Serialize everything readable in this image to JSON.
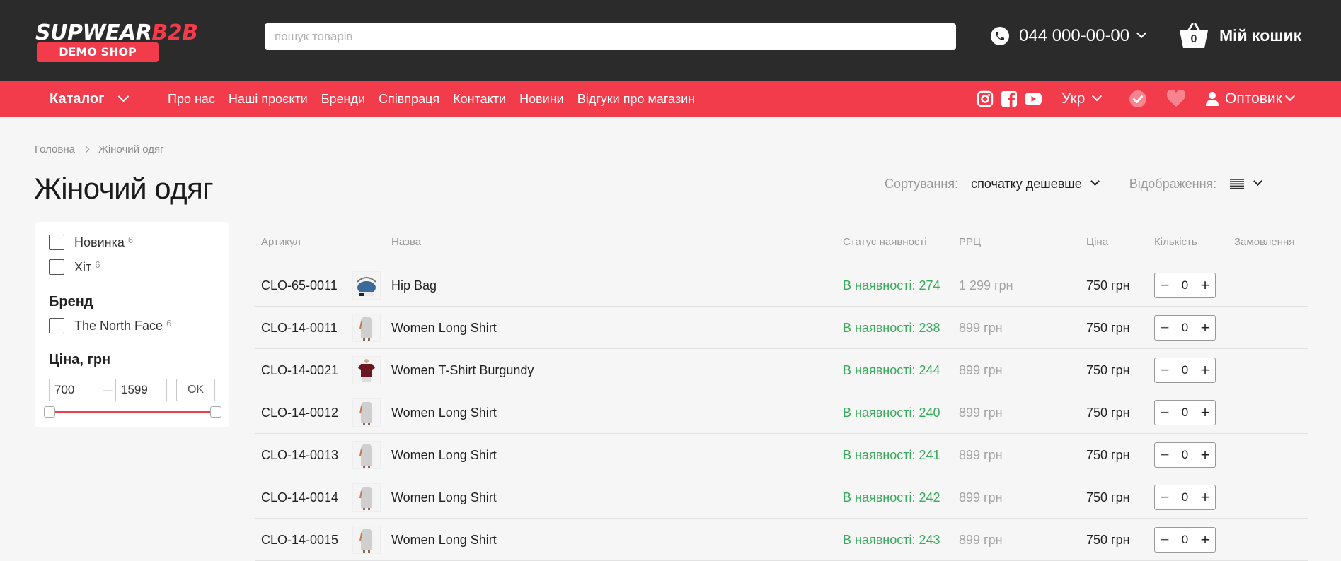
{
  "header": {
    "logo_main": "SUPWEAR",
    "logo_accent": "B2B",
    "logo_sub": "DEMO SHOP",
    "search_placeholder": "пошук товарів",
    "phone": "044 000-00-00",
    "cart_count": "0",
    "cart_label": "Мій кошик"
  },
  "nav": {
    "catalog": "Каталог",
    "links": [
      "Про нас",
      "Наші проєкти",
      "Бренди",
      "Співпраця",
      "Контакти",
      "Новини",
      "Відгуки про магазин"
    ],
    "social_icons": [
      "instagram-icon",
      "facebook-icon",
      "youtube-icon"
    ],
    "language": "Укр",
    "user": "Оптовик",
    "accent_color": "#f23b4b"
  },
  "breadcrumb": [
    "Головна",
    "Жіночий одяг"
  ],
  "page_title": "Жіночий одяг",
  "sort": {
    "label": "Сортування:",
    "value": "спочатку дешевше",
    "view_label": "Відображення:"
  },
  "filters": {
    "tags": [
      {
        "label": "Новинка",
        "count": "6"
      },
      {
        "label": "Хіт",
        "count": "6"
      }
    ],
    "brand_heading": "Бренд",
    "brands": [
      {
        "label": "The North Face",
        "count": "6"
      }
    ],
    "price_heading": "Ціна, грн",
    "price_min": "700",
    "price_max": "1599",
    "price_separator": "—",
    "ok_label": "OK"
  },
  "table": {
    "headers": [
      "Артикул",
      "Назва",
      "Статус наявності",
      "РРЦ",
      "Ціна",
      "Кількість",
      "Замовлення"
    ],
    "rows": [
      {
        "sku": "CLO-65-0011",
        "name": "Hip Bag",
        "status": "В наявності: 274",
        "rrc": "1 299 грн",
        "price": "750 грн",
        "qty": "0",
        "thumb": "bag"
      },
      {
        "sku": "CLO-14-0011",
        "name": "Women Long Shirt",
        "status": "В наявності: 238",
        "rrc": "899 грн",
        "price": "750 грн",
        "qty": "0",
        "thumb": "shirt"
      },
      {
        "sku": "CLO-14-0021",
        "name": "Women T-Shirt Burgundy",
        "status": "В наявності: 244",
        "rrc": "899 грн",
        "price": "750 грн",
        "qty": "0",
        "thumb": "tshirt"
      },
      {
        "sku": "CLO-14-0012",
        "name": "Women Long Shirt",
        "status": "В наявності: 240",
        "rrc": "899 грн",
        "price": "750 грн",
        "qty": "0",
        "thumb": "shirt"
      },
      {
        "sku": "CLO-14-0013",
        "name": "Women Long Shirt",
        "status": "В наявності: 241",
        "rrc": "899 грн",
        "price": "750 грн",
        "qty": "0",
        "thumb": "shirt"
      },
      {
        "sku": "CLO-14-0014",
        "name": "Women Long Shirt",
        "status": "В наявності: 242",
        "rrc": "899 грн",
        "price": "750 грн",
        "qty": "0",
        "thumb": "shirt"
      },
      {
        "sku": "CLO-14-0015",
        "name": "Women Long Shirt",
        "status": "В наявності: 243",
        "rrc": "899 грн",
        "price": "750 грн",
        "qty": "0",
        "thumb": "shirt"
      }
    ]
  },
  "colors": {
    "header_bg": "#2b2b2b",
    "accent": "#f23b4b",
    "in_stock": "#3aaa5c"
  }
}
